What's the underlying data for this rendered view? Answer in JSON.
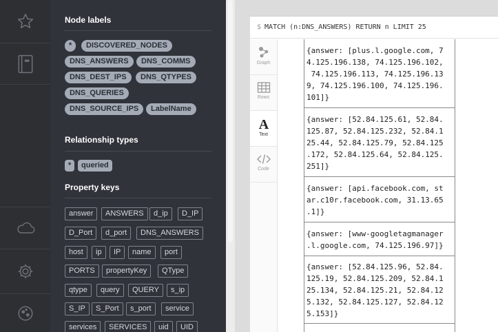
{
  "drawer": {
    "node_labels_title": "Node labels",
    "node_labels": [
      "*",
      "DISCOVERED_NODES",
      "DNS_ANSWERS",
      "DNS_COMMS",
      "DNS_DEST_IPS",
      "DNS_QTYPES",
      "DNS_QUERIES",
      "DNS_SOURCE_IPS",
      "LabelName"
    ],
    "relationship_types_title": "Relationship types",
    "relationship_types": [
      "*",
      "queried"
    ],
    "property_keys_title": "Property keys",
    "property_keys": [
      "answer",
      "ANSWERS",
      "d_ip",
      "D_IP",
      "D_Port",
      "d_port",
      "DNS_ANSWERS",
      "host",
      "ip",
      "IP",
      "name",
      "port",
      "PORTS",
      "propertyKey",
      "QType",
      "qtype",
      "query",
      "QUERY",
      "s_ip",
      "S_IP",
      "S_Port",
      "s_port",
      "service",
      "services",
      "SERVICES",
      "uid",
      "UID"
    ]
  },
  "rail": {
    "icons": [
      "star-icon",
      "book-icon",
      "cloud-icon",
      "gear-icon",
      "about-icon"
    ]
  },
  "editor": {
    "prompt": "$",
    "query": "MATCH (n:DNS_ANSWERS) RETURN n LIMIT 25"
  },
  "tabs": [
    {
      "label": "Graph",
      "icon": "graph-icon"
    },
    {
      "label": "Rows",
      "icon": "table-icon"
    },
    {
      "label": "Text",
      "icon": "text-icon",
      "active": true
    },
    {
      "label": "Code",
      "icon": "code-icon"
    }
  ],
  "results": {
    "rows": [
      {
        "lines": [
          "{answer: [plus.l.google.com, 7",
          "4.125.196.138, 74.125.196.102,",
          " 74.125.196.113, 74.125.196.13",
          "9, 74.125.196.100, 74.125.196.",
          "101]}"
        ]
      },
      {
        "lines": [
          "{answer: [52.84.125.61, 52.84.",
          "125.87, 52.84.125.232, 52.84.1",
          "25.44, 52.84.125.79, 52.84.125",
          ".172, 52.84.125.64, 52.84.125.",
          "251]}"
        ]
      },
      {
        "lines": [
          "{answer: [api.facebook.com, st",
          "ar.c10r.facebook.com, 31.13.65",
          ".1]}"
        ]
      },
      {
        "lines": [
          "{answer: [www-googletagmanager",
          ".l.google.com, 74.125.196.97]}"
        ]
      },
      {
        "lines": [
          "{answer: [52.84.125.96, 52.84.",
          "125.19, 52.84.125.209, 52.84.1",
          "25.134, 52.84.125.21, 52.84.12",
          "5.132, 52.84.125.127, 52.84.12",
          "5.153]}"
        ]
      }
    ]
  },
  "colors": {
    "rail_bg": "#2d2f33",
    "drawer_bg": "#30333a",
    "pill_bg": "#a5abb6",
    "tag_border": "#7f848c"
  }
}
